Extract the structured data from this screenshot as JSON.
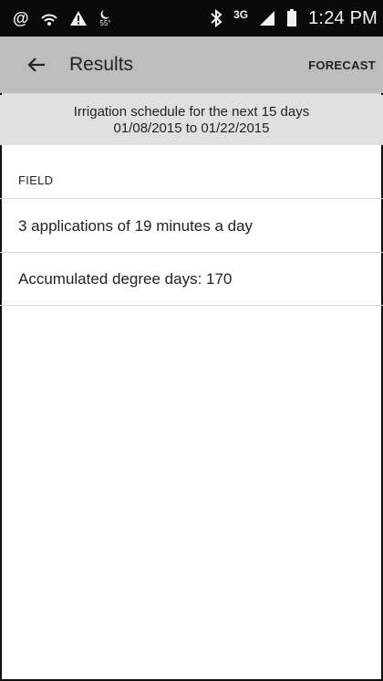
{
  "status_bar": {
    "time": "1:24 PM",
    "network": "3G",
    "icons": [
      "at-icon",
      "wifi-icon",
      "alert-icon",
      "weather-icon",
      "bluetooth-icon",
      "signal-icon",
      "battery-icon"
    ],
    "weather_temp": "55°"
  },
  "app_bar": {
    "title": "Results",
    "action_label": "FORECAST",
    "background": "#bdbdbd"
  },
  "banner": {
    "line1": "Irrigation schedule for the next 15 days",
    "line2": "01/08/2015 to 01/22/2015",
    "background": "#e0e0e0"
  },
  "list": {
    "section_label": "FIELD",
    "items": [
      {
        "text": "3 applications of 19 minutes a day"
      },
      {
        "text": "Accumulated degree days: 170"
      }
    ]
  }
}
